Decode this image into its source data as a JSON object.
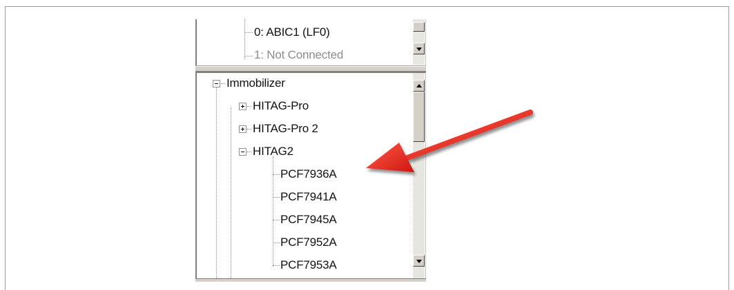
{
  "caption": "",
  "top_panel": {
    "items": [
      {
        "label": "0: ABIC1 (LF0)",
        "dim": false
      },
      {
        "label": "1: Not Connected",
        "dim": true
      }
    ]
  },
  "tree": {
    "root": {
      "label": "Immobilizer",
      "expander": "minus"
    },
    "children": [
      {
        "label": "HITAG-Pro",
        "expander": "plus"
      },
      {
        "label": "HITAG-Pro 2",
        "expander": "plus"
      },
      {
        "label": "HITAG2",
        "expander": "minus"
      }
    ],
    "leaves": [
      "PCF7936A",
      "PCF7941A",
      "PCF7945A",
      "PCF7952A",
      "PCF7953A"
    ]
  },
  "annotation": {
    "arrow_color": "#e8201a",
    "points_to": "PCF7936A"
  }
}
